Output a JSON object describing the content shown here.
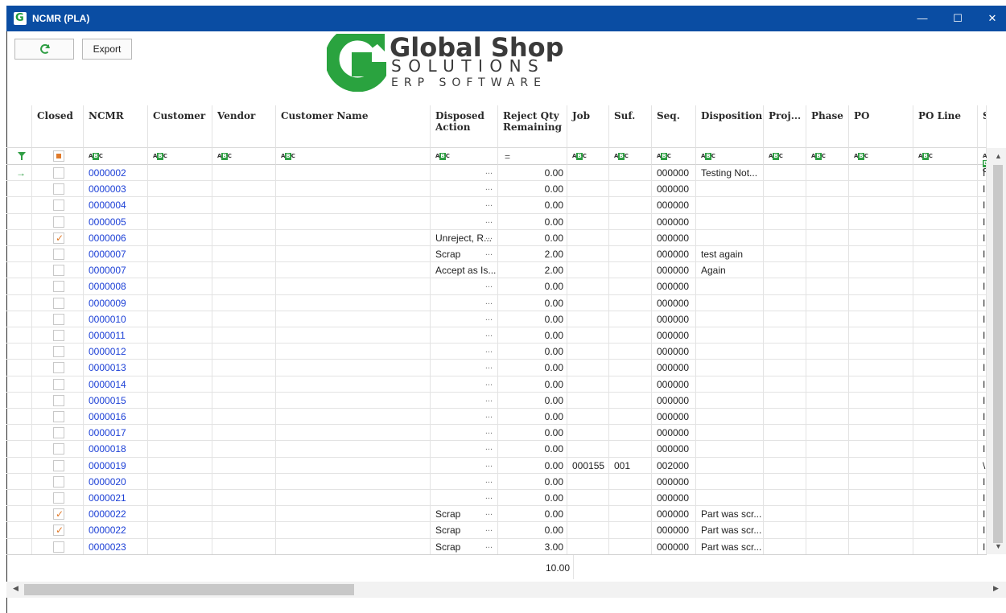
{
  "window": {
    "title": "NCMR (PLA)",
    "minimize": "—",
    "maximize": "☐",
    "close": "✕"
  },
  "toolbar": {
    "refresh_icon": "refresh-icon",
    "export_label": "Export"
  },
  "logo": {
    "line1": "Global Shop",
    "line2": "SOLUTIONS",
    "line3": "ERP SOFTWARE",
    "green": "#2aa33f"
  },
  "colors": {
    "titlebar": "#0a4da3",
    "link": "#1b3fd6",
    "check": "#e07a2a"
  },
  "grid": {
    "columns": [
      {
        "key": "indicator",
        "label": ""
      },
      {
        "key": "closed",
        "label": "Closed"
      },
      {
        "key": "ncmr",
        "label": "NCMR"
      },
      {
        "key": "customer",
        "label": "Customer"
      },
      {
        "key": "vendor",
        "label": "Vendor"
      },
      {
        "key": "customer_name",
        "label": "Customer Name"
      },
      {
        "key": "disposed_action",
        "label": "Disposed Action"
      },
      {
        "key": "reject_qty",
        "label": "Reject Qty Remaining"
      },
      {
        "key": "job",
        "label": "Job"
      },
      {
        "key": "suf",
        "label": "Suf."
      },
      {
        "key": "seq",
        "label": "Seq."
      },
      {
        "key": "disposition",
        "label": "Disposition"
      },
      {
        "key": "proj",
        "label": "Proj..."
      },
      {
        "key": "phase",
        "label": "Phase"
      },
      {
        "key": "po",
        "label": "PO"
      },
      {
        "key": "po_line",
        "label": "PO Line"
      },
      {
        "key": "sou",
        "label": "Sou"
      }
    ],
    "rows": [
      {
        "current": true,
        "closed": false,
        "ncmr": "0000002",
        "disposed_action": "",
        "reject_qty": "0.00",
        "job": "",
        "suf": "",
        "seq": "000000",
        "disposition": "Testing Not...",
        "sou": "I"
      },
      {
        "closed": false,
        "ncmr": "0000003",
        "disposed_action": "",
        "reject_qty": "0.00",
        "job": "",
        "suf": "",
        "seq": "000000",
        "disposition": "",
        "sou": "I"
      },
      {
        "closed": false,
        "ncmr": "0000004",
        "disposed_action": "",
        "reject_qty": "0.00",
        "job": "",
        "suf": "",
        "seq": "000000",
        "disposition": "",
        "sou": "I"
      },
      {
        "closed": false,
        "ncmr": "0000005",
        "disposed_action": "",
        "reject_qty": "0.00",
        "job": "",
        "suf": "",
        "seq": "000000",
        "disposition": "",
        "sou": "I"
      },
      {
        "closed": true,
        "ncmr": "0000006",
        "disposed_action": "Unreject, R...",
        "reject_qty": "0.00",
        "job": "",
        "suf": "",
        "seq": "000000",
        "disposition": "",
        "sou": "I"
      },
      {
        "closed": false,
        "ncmr": "0000007",
        "disposed_action": "Scrap",
        "reject_qty": "2.00",
        "job": "",
        "suf": "",
        "seq": "000000",
        "disposition": "test again",
        "sou": "I"
      },
      {
        "closed": false,
        "ncmr": "0000007",
        "disposed_action": "Accept as Is...",
        "reject_qty": "2.00",
        "job": "",
        "suf": "",
        "seq": "000000",
        "disposition": "Again",
        "sou": "I",
        "no_ellip": true
      },
      {
        "closed": false,
        "ncmr": "0000008",
        "disposed_action": "",
        "reject_qty": "0.00",
        "job": "",
        "suf": "",
        "seq": "000000",
        "disposition": "",
        "sou": "I"
      },
      {
        "closed": false,
        "ncmr": "0000009",
        "disposed_action": "",
        "reject_qty": "0.00",
        "job": "",
        "suf": "",
        "seq": "000000",
        "disposition": "",
        "sou": "I"
      },
      {
        "closed": false,
        "ncmr": "0000010",
        "disposed_action": "",
        "reject_qty": "0.00",
        "job": "",
        "suf": "",
        "seq": "000000",
        "disposition": "",
        "sou": "I"
      },
      {
        "closed": false,
        "ncmr": "0000011",
        "disposed_action": "",
        "reject_qty": "0.00",
        "job": "",
        "suf": "",
        "seq": "000000",
        "disposition": "",
        "sou": "I"
      },
      {
        "closed": false,
        "ncmr": "0000012",
        "disposed_action": "",
        "reject_qty": "0.00",
        "job": "",
        "suf": "",
        "seq": "000000",
        "disposition": "",
        "sou": "I"
      },
      {
        "closed": false,
        "ncmr": "0000013",
        "disposed_action": "",
        "reject_qty": "0.00",
        "job": "",
        "suf": "",
        "seq": "000000",
        "disposition": "",
        "sou": "I"
      },
      {
        "closed": false,
        "ncmr": "0000014",
        "disposed_action": "",
        "reject_qty": "0.00",
        "job": "",
        "suf": "",
        "seq": "000000",
        "disposition": "",
        "sou": "I"
      },
      {
        "closed": false,
        "ncmr": "0000015",
        "disposed_action": "",
        "reject_qty": "0.00",
        "job": "",
        "suf": "",
        "seq": "000000",
        "disposition": "",
        "sou": "I"
      },
      {
        "closed": false,
        "ncmr": "0000016",
        "disposed_action": "",
        "reject_qty": "0.00",
        "job": "",
        "suf": "",
        "seq": "000000",
        "disposition": "",
        "sou": "I"
      },
      {
        "closed": false,
        "ncmr": "0000017",
        "disposed_action": "",
        "reject_qty": "0.00",
        "job": "",
        "suf": "",
        "seq": "000000",
        "disposition": "",
        "sou": "I"
      },
      {
        "closed": false,
        "ncmr": "0000018",
        "disposed_action": "",
        "reject_qty": "0.00",
        "job": "",
        "suf": "",
        "seq": "000000",
        "disposition": "",
        "sou": "I"
      },
      {
        "closed": false,
        "ncmr": "0000019",
        "disposed_action": "",
        "reject_qty": "0.00",
        "job": "000155",
        "suf": "001",
        "seq": "002000",
        "disposition": "",
        "sou": "\\"
      },
      {
        "closed": false,
        "ncmr": "0000020",
        "disposed_action": "",
        "reject_qty": "0.00",
        "job": "",
        "suf": "",
        "seq": "000000",
        "disposition": "",
        "sou": "I"
      },
      {
        "closed": false,
        "ncmr": "0000021",
        "disposed_action": "",
        "reject_qty": "0.00",
        "job": "",
        "suf": "",
        "seq": "000000",
        "disposition": "",
        "sou": "I"
      },
      {
        "closed": true,
        "ncmr": "0000022",
        "disposed_action": "Scrap",
        "reject_qty": "0.00",
        "job": "",
        "suf": "",
        "seq": "000000",
        "disposition": "Part was scr...",
        "sou": "I"
      },
      {
        "closed": true,
        "ncmr": "0000022",
        "disposed_action": "Scrap",
        "reject_qty": "0.00",
        "job": "",
        "suf": "",
        "seq": "000000",
        "disposition": "Part was scr...",
        "sou": "I"
      },
      {
        "closed": false,
        "ncmr": "0000023",
        "disposed_action": "Scrap",
        "reject_qty": "3.00",
        "job": "",
        "suf": "",
        "seq": "000000",
        "disposition": "Part was scr...",
        "sou": "I"
      }
    ],
    "total_reject_qty": "10.00",
    "ellipsis": "..."
  }
}
